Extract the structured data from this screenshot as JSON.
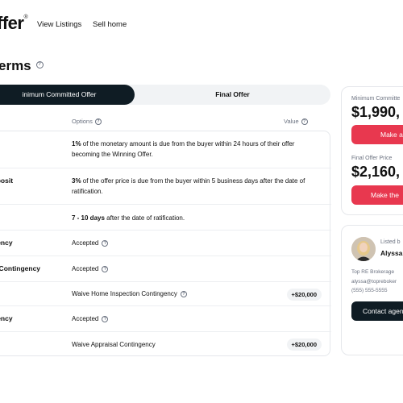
{
  "nav": {
    "logo": "ffer",
    "logo_mark": "®",
    "links": [
      "View Listings",
      "Sell home"
    ]
  },
  "page": {
    "title": "erms"
  },
  "tabs": [
    {
      "label": "inimum Committed Offer",
      "active": true
    },
    {
      "label": "Final Offer",
      "active": false
    }
  ],
  "table_headers": {
    "options": "Options",
    "value": "Value"
  },
  "rows": [
    {
      "label": "",
      "option_bold": "1%",
      "option_text": " of the monetary amount is due from the buyer within 24 hours of their offer becoming the Winning Offer.",
      "value": ""
    },
    {
      "label": "eposit",
      "option_bold": "3%",
      "option_text": " of the offer price is due from the buyer within 5 business days after the date of ratification.",
      "value": ""
    },
    {
      "label": "",
      "option_bold": "7 - 10 days",
      "option_text": " after the date of ratification.",
      "value": ""
    },
    {
      "label": "gency",
      "option_bold": "",
      "option_text": "Accepted",
      "value": ""
    },
    {
      "label": "n Contingency",
      "option_bold": "",
      "option_text": "Accepted",
      "value": ""
    },
    {
      "label": "",
      "option_bold": "",
      "option_text": "Waive Home Inspection Contingency",
      "value": "+$20,000"
    },
    {
      "label": "gency",
      "option_bold": "",
      "option_text": "Accepted",
      "value": ""
    },
    {
      "label": "",
      "option_bold": "",
      "option_text": "Waive Appraisal Contingency",
      "value": "+$20,000"
    }
  ],
  "offer_card": {
    "min_label": "Minimum Committe",
    "min_price": "$1,990,",
    "min_button": "Make a",
    "final_label": "Final Offer Price",
    "final_price": "$2,160,",
    "final_button": "Make the"
  },
  "agent_card": {
    "listed_by": "Listed b",
    "name": "Alyssa",
    "brokerage": "Top RE Brokerage",
    "email": "alyssa@topreboker",
    "phone": "(555) 555-5555",
    "contact_button": "Contact agen"
  },
  "colors": {
    "accent": "#e8384f",
    "dark": "#0f1c24"
  }
}
